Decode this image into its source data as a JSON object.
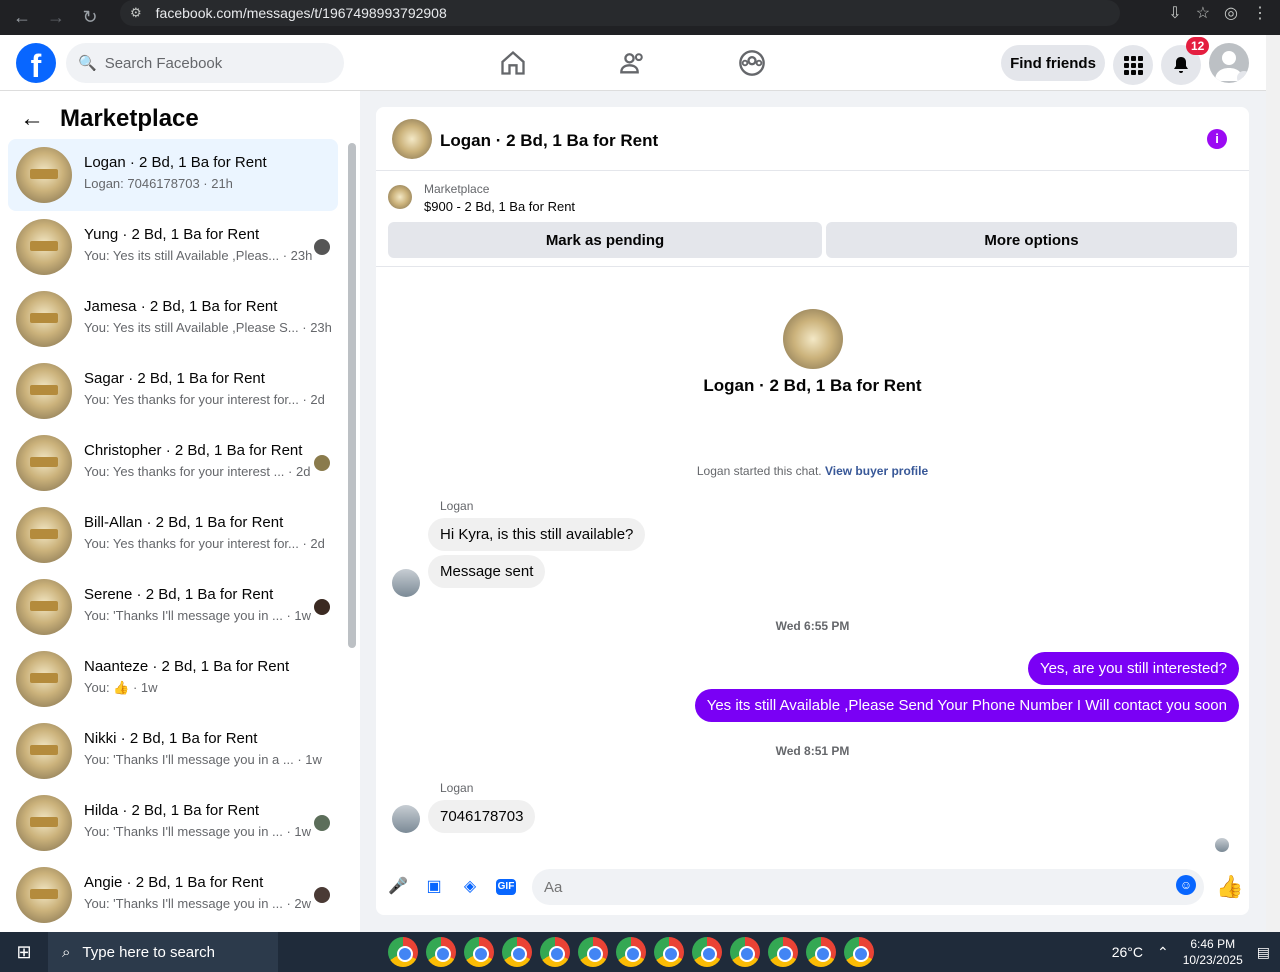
{
  "browser": {
    "url": "facebook.com/messages/t/1967498993792908"
  },
  "header": {
    "search_placeholder": "Search Facebook",
    "find_friends_label": "Find friends",
    "notifications_count": "12"
  },
  "sidebar": {
    "title": "Marketplace",
    "conversations": [
      {
        "name": "Logan · 2 Bd, 1 Ba for Rent",
        "preview": "Logan: 7046178703 · 21h",
        "active": true
      },
      {
        "name": "Yung · 2 Bd, 1 Ba for Rent",
        "preview": "You: Yes its still Available ,Pleas... · 23h"
      },
      {
        "name": "Jamesa · 2 Bd, 1 Ba for Rent",
        "preview": "You: Yes its still Available ,Please S... · 23h"
      },
      {
        "name": "Sagar · 2 Bd, 1 Ba for Rent",
        "preview": "You: Yes thanks for your interest for... · 2d"
      },
      {
        "name": "Christopher · 2 Bd, 1 Ba for Rent",
        "preview": "You: Yes thanks for your interest ... · 2d"
      },
      {
        "name": "Bill-Allan · 2 Bd, 1 Ba for Rent",
        "preview": "You: Yes thanks for your interest for... · 2d"
      },
      {
        "name": "Serene · 2 Bd, 1 Ba for Rent",
        "preview": "You: 'Thanks I'll message you in ... · 1w"
      },
      {
        "name": "Naanteze · 2 Bd, 1 Ba for Rent",
        "preview": "You: 👍 · 1w"
      },
      {
        "name": "Nikki · 2 Bd, 1 Ba for Rent",
        "preview": "You: 'Thanks I'll message you in a ... · 1w"
      },
      {
        "name": "Hilda · 2 Bd, 1 Ba for Rent",
        "preview": "You: 'Thanks I'll message you in ... · 1w"
      },
      {
        "name": "Angie · 2 Bd, 1 Ba for Rent",
        "preview": "You: 'Thanks I'll message you in ... · 2w"
      }
    ]
  },
  "chat": {
    "title": "Logan · 2 Bd, 1 Ba for Rent",
    "marketplace_label": "Marketplace",
    "listing_price": "$900 - 2 Bd, 1 Ba for Rent",
    "mark_pending_label": "Mark as pending",
    "more_options_label": "More options",
    "center_name": "Logan · 2 Bd, 1 Ba for Rent",
    "started_text": "Logan started this chat.",
    "view_profile_label": "View buyer profile",
    "sender_name": "Logan",
    "msg_in_1": "Hi Kyra, is this still available?",
    "msg_in_2": "Message sent",
    "ts_1": "Wed 6:55 PM",
    "msg_out_1": "Yes, are you still interested?",
    "msg_out_2": "Yes its still Available ,Please Send Your Phone Number I Will contact you soon",
    "ts_2": "Wed 8:51 PM",
    "msg_in_3": "7046178703",
    "input_placeholder": "Aa"
  },
  "taskbar": {
    "search_placeholder": "Type here to search",
    "temperature": "26°C",
    "time": "6:46 PM",
    "date": "10/23/2025"
  },
  "colors": {
    "accent_blue": "#0866ff",
    "outgoing_bubble": "#7a00f5",
    "info_icon": "#9b0af3"
  }
}
